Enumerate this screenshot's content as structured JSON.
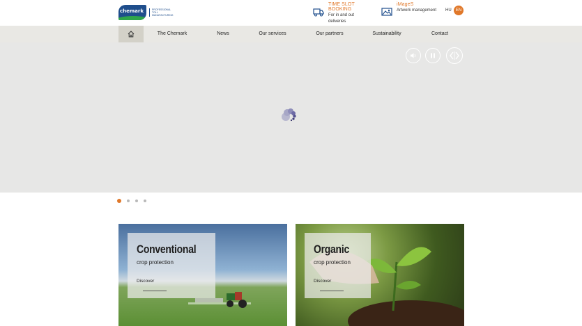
{
  "header": {
    "logo_text": "chemark",
    "logo_tagline": "PROFESSIONAL TOLL MANUFACTURING",
    "quick_links": [
      {
        "title": "TIME SLOT BOOKING",
        "subtitle": "For in and out deliveries",
        "icon": "truck-icon"
      },
      {
        "title": "iMageS",
        "subtitle": "Artwork management",
        "icon": "image-icon"
      }
    ],
    "languages": [
      "HU",
      "EN"
    ],
    "active_language": "EN"
  },
  "nav": {
    "home_icon": "home-icon",
    "items": [
      "The Chemark",
      "News",
      "Our services",
      "Our partners",
      "Sustainability",
      "Contact"
    ]
  },
  "hero": {
    "controls": [
      "sound-icon",
      "pause-icon",
      "prev-next-icon"
    ],
    "loading": true
  },
  "slider": {
    "slide_count": 4,
    "active_index": 0
  },
  "cards": [
    {
      "title": "Conventional",
      "subtitle": "crop protection",
      "link": "Discover"
    },
    {
      "title": "Organic",
      "subtitle": "crop protection",
      "link": "Discover"
    }
  ],
  "colors": {
    "accent": "#e0782a",
    "brand_blue": "#1f4e8c",
    "nav_bg": "#e9e8e4",
    "hero_bg": "#e7e7e6"
  }
}
